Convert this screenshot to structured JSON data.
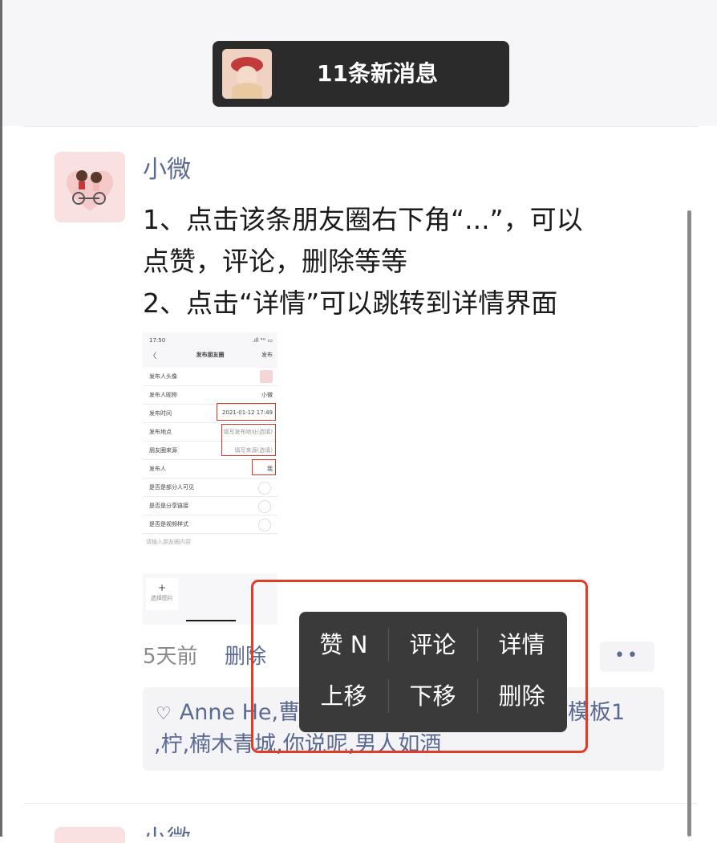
{
  "banner": {
    "text": "11条新消息"
  },
  "post": {
    "nickname": "小微",
    "lines": [
      "1、点击该条朋友圈右下角“...”，可以",
      "点赞，评论，删除等等",
      "2、点击“详情”可以跳转到详情界面"
    ],
    "time": "5天前",
    "delete_label": "删除",
    "more_label": "••",
    "likes_line1": "Anne He,曹",
    "likes_line1_tail": "模板1",
    "likes_line2": ",柠,楠木青城,你说呢,男人如酒"
  },
  "screenshot": {
    "status_time": "17:50",
    "status_icons": ".ıll ⁴ᴳ ▭",
    "back": "〈",
    "title": "发布朋友圈",
    "publish": "发布",
    "rows": [
      {
        "label": "发布人头像",
        "value": ""
      },
      {
        "label": "发布人昵称",
        "value": "小微"
      },
      {
        "label": "发布时间",
        "value": "2021-01-12 17:49"
      },
      {
        "label": "发布地点",
        "value": "填写发布地址(选填)"
      },
      {
        "label": "朋友圈来源",
        "value": "填写来源(选填)"
      },
      {
        "label": "发布人",
        "value": "我"
      },
      {
        "label": "是否是部分人可见",
        "value": ""
      },
      {
        "label": "是否是分享链接",
        "value": ""
      },
      {
        "label": "是否是视频样式",
        "value": ""
      }
    ],
    "content_placeholder": "请输入朋友圈内容",
    "add_symbol": "+",
    "add_label": "选择图片"
  },
  "menu": {
    "row1": [
      "赞 N",
      "评论",
      "详情"
    ],
    "row2": [
      "上移",
      "下移",
      "删除"
    ]
  },
  "next_post": {
    "nickname": "小微"
  },
  "colors": {
    "link": "#5b6a91",
    "accent_red": "#e23b26",
    "menu_bg": "#3a3a3a"
  }
}
